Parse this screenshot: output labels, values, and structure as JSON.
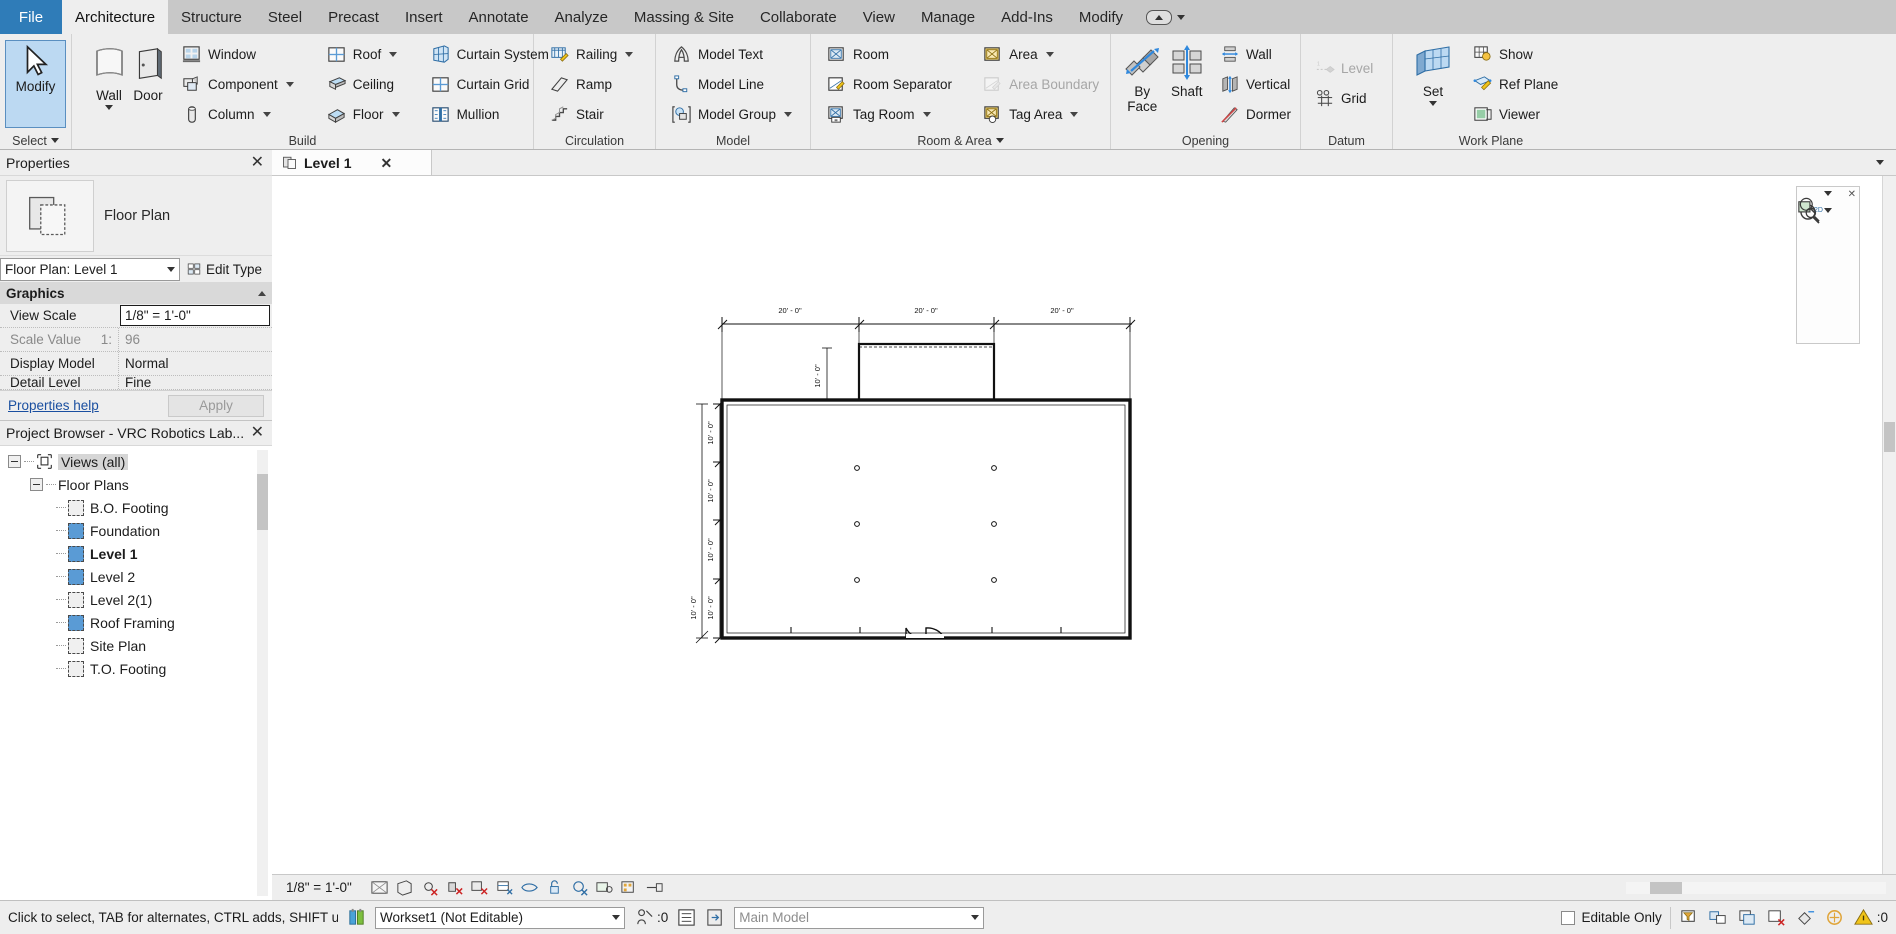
{
  "tabs": [
    {
      "label": "File",
      "kind": "file"
    },
    {
      "label": "Architecture",
      "active": true
    },
    {
      "label": "Structure"
    },
    {
      "label": "Steel"
    },
    {
      "label": "Precast"
    },
    {
      "label": "Insert"
    },
    {
      "label": "Annotate"
    },
    {
      "label": "Analyze"
    },
    {
      "label": "Massing & Site"
    },
    {
      "label": "Collaborate"
    },
    {
      "label": "View"
    },
    {
      "label": "Manage"
    },
    {
      "label": "Add-Ins"
    },
    {
      "label": "Modify"
    }
  ],
  "ribbon": {
    "select": {
      "title": "Select",
      "modify_label": "Modify"
    },
    "build": {
      "title": "Build",
      "wall_label": "Wall",
      "door_label": "Door",
      "window_label": "Window",
      "component_label": "Component",
      "column_label": "Column",
      "roof_label": "Roof",
      "ceiling_label": "Ceiling",
      "floor_label": "Floor",
      "curtain_system_label": "Curtain System",
      "curtain_grid_label": "Curtain Grid",
      "mullion_label": "Mullion"
    },
    "circulation": {
      "title": "Circulation",
      "railing_label": "Railing",
      "ramp_label": "Ramp",
      "stair_label": "Stair"
    },
    "model": {
      "title": "Model",
      "model_text_label": "Model Text",
      "model_line_label": "Model Line",
      "model_group_label": "Model Group"
    },
    "room_area": {
      "title": "Room & Area",
      "room_label": "Room",
      "room_separator_label": "Room Separator",
      "tag_room_label": "Tag Room",
      "area_label": "Area",
      "area_boundary_label": "Area Boundary",
      "tag_area_label": "Tag Area"
    },
    "opening": {
      "title": "Opening",
      "by_face_label_1": "By",
      "by_face_label_2": "Face",
      "shaft_label": "Shaft",
      "wall_label": "Wall",
      "vertical_label": "Vertical",
      "dormer_label": "Dormer"
    },
    "datum": {
      "title": "Datum",
      "level_label": "Level",
      "grid_label": "Grid"
    },
    "workplane": {
      "title": "Work Plane",
      "set_label": "Set",
      "show_label": "Show",
      "ref_plane_label": "Ref Plane",
      "viewer_label": "Viewer"
    }
  },
  "properties": {
    "title": "Properties",
    "family_name": "Floor Plan",
    "type_selector": "Floor Plan: Level 1",
    "edit_type_label": "Edit Type",
    "section_graphics": "Graphics",
    "rows": [
      {
        "name": "View Scale",
        "value": "1/8\" = 1'-0\"",
        "boxed": true
      },
      {
        "name": "Scale Value",
        "suffix": "1:",
        "value": "96",
        "dim": true
      },
      {
        "name": "Display Model",
        "value": "Normal"
      },
      {
        "name": "Detail Level",
        "value": "Fine"
      }
    ],
    "help_link": "Properties help",
    "apply_label": "Apply"
  },
  "project_browser": {
    "title": "Project Browser - VRC Robotics Lab...",
    "nodes": [
      {
        "label": "Views (all)",
        "depth": 0,
        "type": "group",
        "selected": true
      },
      {
        "label": "Floor Plans",
        "depth": 1,
        "type": "group"
      },
      {
        "label": "B.O. Footing",
        "depth": 2,
        "type": "view",
        "active": false
      },
      {
        "label": "Foundation",
        "depth": 2,
        "type": "view",
        "active": true
      },
      {
        "label": "Level 1",
        "depth": 2,
        "type": "view",
        "active": true,
        "bold": true
      },
      {
        "label": "Level 2",
        "depth": 2,
        "type": "view",
        "active": true
      },
      {
        "label": "Level 2(1)",
        "depth": 2,
        "type": "view",
        "active": false
      },
      {
        "label": "Roof Framing",
        "depth": 2,
        "type": "view",
        "active": true
      },
      {
        "label": "Site Plan",
        "depth": 2,
        "type": "view",
        "active": false
      },
      {
        "label": "T.O. Footing",
        "depth": 2,
        "type": "view",
        "active": false
      }
    ]
  },
  "view": {
    "tab_label": "Level 1",
    "scale_label": "1/8\" = 1'-0\"",
    "dimensions": {
      "top": [
        "20' - 0\"",
        "20' - 0\"",
        "20' - 0\""
      ],
      "left": [
        "10' - 0\"",
        "10' - 0\"",
        "10' - 0\"",
        "10' - 0\"",
        "10' - 0\""
      ],
      "inset": "10' - 0\""
    }
  },
  "statusbar": {
    "hint": "Click to select, TAB for alternates, CTRL adds, SHIFT u",
    "workset": "Workset1 (Not Editable)",
    "warning_count": ":0",
    "design_option": "Main Model",
    "editable_only_label": "Editable Only",
    "exclude_count": ":0"
  },
  "colors": {
    "file_tab": "#2f7cb8",
    "ribbon_bg": "#eeeeee",
    "tabbar_bg": "#c8c8c8",
    "selected_blue": "#bcd9f2",
    "view_icon_blue": "#5a9bd5",
    "link_blue": "#1a4fa0"
  }
}
